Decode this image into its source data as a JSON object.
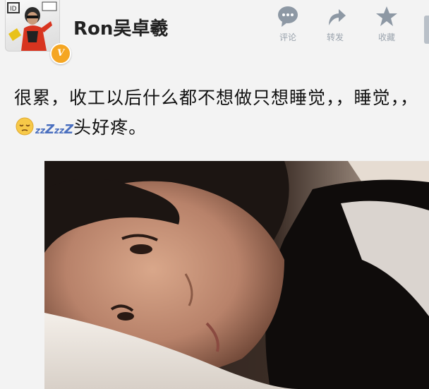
{
  "user": {
    "name": "Ron吴卓羲",
    "badge": "V"
  },
  "actions": [
    {
      "label": "评论",
      "icon": "comment-icon"
    },
    {
      "label": "转发",
      "icon": "repost-icon"
    },
    {
      "label": "收藏",
      "icon": "star-icon"
    }
  ],
  "post": {
    "text_before": "很累，收工以后什么都不想做只想睡觉，，睡觉，，",
    "emoji": "sleepy-face-icon",
    "zzz": [
      "z",
      "z",
      "Z",
      "z",
      "z",
      "Z"
    ],
    "text_after": "头好疼。"
  },
  "colors": {
    "action_gray": "#9aa3ad",
    "badge": "#f5a623",
    "zzz": "#4a6fbf"
  }
}
